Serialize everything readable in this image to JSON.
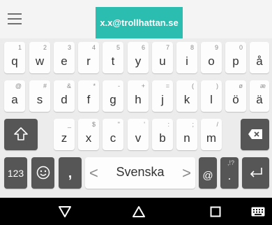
{
  "top_bar": {
    "menu_icon": "hamburger-menu-icon",
    "suggestion": "x.x@trollhattan.se",
    "suggestion_color": "#2bbdb0"
  },
  "keyboard": {
    "row1": [
      {
        "label": "q",
        "hint": "1"
      },
      {
        "label": "w",
        "hint": "2"
      },
      {
        "label": "e",
        "hint": "3"
      },
      {
        "label": "r",
        "hint": "4"
      },
      {
        "label": "t",
        "hint": "5"
      },
      {
        "label": "y",
        "hint": "6"
      },
      {
        "label": "u",
        "hint": "7"
      },
      {
        "label": "i",
        "hint": "8"
      },
      {
        "label": "o",
        "hint": "9"
      },
      {
        "label": "p",
        "hint": "0"
      },
      {
        "label": "å",
        "hint": ""
      }
    ],
    "row2": [
      {
        "label": "a",
        "hint": "@"
      },
      {
        "label": "s",
        "hint": "#"
      },
      {
        "label": "d",
        "hint": "&"
      },
      {
        "label": "f",
        "hint": "*"
      },
      {
        "label": "g",
        "hint": "-"
      },
      {
        "label": "h",
        "hint": "+"
      },
      {
        "label": "j",
        "hint": "="
      },
      {
        "label": "k",
        "hint": "("
      },
      {
        "label": "l",
        "hint": ")"
      },
      {
        "label": "ö",
        "hint": "ø"
      },
      {
        "label": "ä",
        "hint": "æ"
      }
    ],
    "row3": [
      {
        "label": "z",
        "hint": "_"
      },
      {
        "label": "x",
        "hint": "$"
      },
      {
        "label": "c",
        "hint": "\""
      },
      {
        "label": "v",
        "hint": "'"
      },
      {
        "label": "b",
        "hint": ":"
      },
      {
        "label": "n",
        "hint": ";"
      },
      {
        "label": "m",
        "hint": "/"
      }
    ],
    "symbols_key": "123",
    "comma_key": ",",
    "space_label": "Svenska",
    "at_key": "@",
    "period_key": ".",
    "period_hint": ",!?",
    "icons": {
      "shift": "shift-arrow-icon",
      "backspace": "backspace-icon",
      "emoji": "emoji-smiley-icon",
      "enter": "enter-return-icon"
    }
  },
  "nav_bar": {
    "back": "back-triangle-icon",
    "home": "home-triangle-icon",
    "recents": "recents-square-icon",
    "keyboard": "keyboard-switch-icon"
  }
}
